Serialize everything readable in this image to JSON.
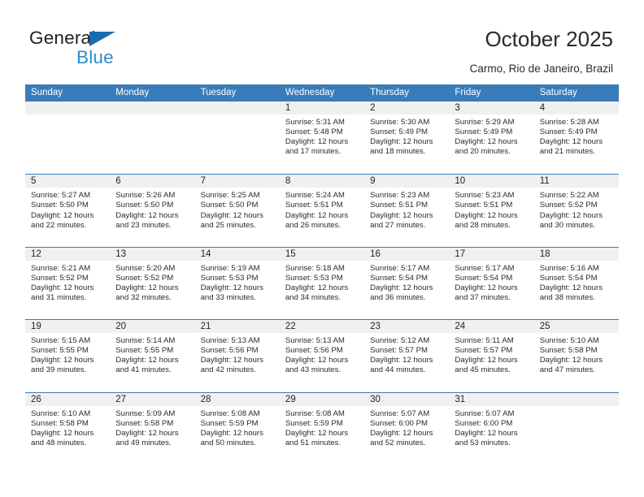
{
  "brand": {
    "name_part1": "General",
    "name_part2": "Blue",
    "triangle_icon": "triangle-icon",
    "accent_dark": "#1a6bb0",
    "accent_light": "#2e8bd0"
  },
  "header": {
    "title": "October 2025",
    "subtitle": "Carmo, Rio de Janeiro, Brazil"
  },
  "calendar": {
    "header_bg": "#3a7cb9",
    "daynum_bg": "#f0f0f0",
    "weekdays": [
      "Sunday",
      "Monday",
      "Tuesday",
      "Wednesday",
      "Thursday",
      "Friday",
      "Saturday"
    ],
    "weeks": [
      [
        {
          "day": "",
          "sunrise": "",
          "sunset": "",
          "daylight1": "",
          "daylight2": ""
        },
        {
          "day": "",
          "sunrise": "",
          "sunset": "",
          "daylight1": "",
          "daylight2": ""
        },
        {
          "day": "",
          "sunrise": "",
          "sunset": "",
          "daylight1": "",
          "daylight2": ""
        },
        {
          "day": "1",
          "sunrise": "Sunrise: 5:31 AM",
          "sunset": "Sunset: 5:48 PM",
          "daylight1": "Daylight: 12 hours",
          "daylight2": "and 17 minutes."
        },
        {
          "day": "2",
          "sunrise": "Sunrise: 5:30 AM",
          "sunset": "Sunset: 5:49 PM",
          "daylight1": "Daylight: 12 hours",
          "daylight2": "and 18 minutes."
        },
        {
          "day": "3",
          "sunrise": "Sunrise: 5:29 AM",
          "sunset": "Sunset: 5:49 PM",
          "daylight1": "Daylight: 12 hours",
          "daylight2": "and 20 minutes."
        },
        {
          "day": "4",
          "sunrise": "Sunrise: 5:28 AM",
          "sunset": "Sunset: 5:49 PM",
          "daylight1": "Daylight: 12 hours",
          "daylight2": "and 21 minutes."
        }
      ],
      [
        {
          "day": "5",
          "sunrise": "Sunrise: 5:27 AM",
          "sunset": "Sunset: 5:50 PM",
          "daylight1": "Daylight: 12 hours",
          "daylight2": "and 22 minutes."
        },
        {
          "day": "6",
          "sunrise": "Sunrise: 5:26 AM",
          "sunset": "Sunset: 5:50 PM",
          "daylight1": "Daylight: 12 hours",
          "daylight2": "and 23 minutes."
        },
        {
          "day": "7",
          "sunrise": "Sunrise: 5:25 AM",
          "sunset": "Sunset: 5:50 PM",
          "daylight1": "Daylight: 12 hours",
          "daylight2": "and 25 minutes."
        },
        {
          "day": "8",
          "sunrise": "Sunrise: 5:24 AM",
          "sunset": "Sunset: 5:51 PM",
          "daylight1": "Daylight: 12 hours",
          "daylight2": "and 26 minutes."
        },
        {
          "day": "9",
          "sunrise": "Sunrise: 5:23 AM",
          "sunset": "Sunset: 5:51 PM",
          "daylight1": "Daylight: 12 hours",
          "daylight2": "and 27 minutes."
        },
        {
          "day": "10",
          "sunrise": "Sunrise: 5:23 AM",
          "sunset": "Sunset: 5:51 PM",
          "daylight1": "Daylight: 12 hours",
          "daylight2": "and 28 minutes."
        },
        {
          "day": "11",
          "sunrise": "Sunrise: 5:22 AM",
          "sunset": "Sunset: 5:52 PM",
          "daylight1": "Daylight: 12 hours",
          "daylight2": "and 30 minutes."
        }
      ],
      [
        {
          "day": "12",
          "sunrise": "Sunrise: 5:21 AM",
          "sunset": "Sunset: 5:52 PM",
          "daylight1": "Daylight: 12 hours",
          "daylight2": "and 31 minutes."
        },
        {
          "day": "13",
          "sunrise": "Sunrise: 5:20 AM",
          "sunset": "Sunset: 5:52 PM",
          "daylight1": "Daylight: 12 hours",
          "daylight2": "and 32 minutes."
        },
        {
          "day": "14",
          "sunrise": "Sunrise: 5:19 AM",
          "sunset": "Sunset: 5:53 PM",
          "daylight1": "Daylight: 12 hours",
          "daylight2": "and 33 minutes."
        },
        {
          "day": "15",
          "sunrise": "Sunrise: 5:18 AM",
          "sunset": "Sunset: 5:53 PM",
          "daylight1": "Daylight: 12 hours",
          "daylight2": "and 34 minutes."
        },
        {
          "day": "16",
          "sunrise": "Sunrise: 5:17 AM",
          "sunset": "Sunset: 5:54 PM",
          "daylight1": "Daylight: 12 hours",
          "daylight2": "and 36 minutes."
        },
        {
          "day": "17",
          "sunrise": "Sunrise: 5:17 AM",
          "sunset": "Sunset: 5:54 PM",
          "daylight1": "Daylight: 12 hours",
          "daylight2": "and 37 minutes."
        },
        {
          "day": "18",
          "sunrise": "Sunrise: 5:16 AM",
          "sunset": "Sunset: 5:54 PM",
          "daylight1": "Daylight: 12 hours",
          "daylight2": "and 38 minutes."
        }
      ],
      [
        {
          "day": "19",
          "sunrise": "Sunrise: 5:15 AM",
          "sunset": "Sunset: 5:55 PM",
          "daylight1": "Daylight: 12 hours",
          "daylight2": "and 39 minutes."
        },
        {
          "day": "20",
          "sunrise": "Sunrise: 5:14 AM",
          "sunset": "Sunset: 5:55 PM",
          "daylight1": "Daylight: 12 hours",
          "daylight2": "and 41 minutes."
        },
        {
          "day": "21",
          "sunrise": "Sunrise: 5:13 AM",
          "sunset": "Sunset: 5:56 PM",
          "daylight1": "Daylight: 12 hours",
          "daylight2": "and 42 minutes."
        },
        {
          "day": "22",
          "sunrise": "Sunrise: 5:13 AM",
          "sunset": "Sunset: 5:56 PM",
          "daylight1": "Daylight: 12 hours",
          "daylight2": "and 43 minutes."
        },
        {
          "day": "23",
          "sunrise": "Sunrise: 5:12 AM",
          "sunset": "Sunset: 5:57 PM",
          "daylight1": "Daylight: 12 hours",
          "daylight2": "and 44 minutes."
        },
        {
          "day": "24",
          "sunrise": "Sunrise: 5:11 AM",
          "sunset": "Sunset: 5:57 PM",
          "daylight1": "Daylight: 12 hours",
          "daylight2": "and 45 minutes."
        },
        {
          "day": "25",
          "sunrise": "Sunrise: 5:10 AM",
          "sunset": "Sunset: 5:58 PM",
          "daylight1": "Daylight: 12 hours",
          "daylight2": "and 47 minutes."
        }
      ],
      [
        {
          "day": "26",
          "sunrise": "Sunrise: 5:10 AM",
          "sunset": "Sunset: 5:58 PM",
          "daylight1": "Daylight: 12 hours",
          "daylight2": "and 48 minutes."
        },
        {
          "day": "27",
          "sunrise": "Sunrise: 5:09 AM",
          "sunset": "Sunset: 5:58 PM",
          "daylight1": "Daylight: 12 hours",
          "daylight2": "and 49 minutes."
        },
        {
          "day": "28",
          "sunrise": "Sunrise: 5:08 AM",
          "sunset": "Sunset: 5:59 PM",
          "daylight1": "Daylight: 12 hours",
          "daylight2": "and 50 minutes."
        },
        {
          "day": "29",
          "sunrise": "Sunrise: 5:08 AM",
          "sunset": "Sunset: 5:59 PM",
          "daylight1": "Daylight: 12 hours",
          "daylight2": "and 51 minutes."
        },
        {
          "day": "30",
          "sunrise": "Sunrise: 5:07 AM",
          "sunset": "Sunset: 6:00 PM",
          "daylight1": "Daylight: 12 hours",
          "daylight2": "and 52 minutes."
        },
        {
          "day": "31",
          "sunrise": "Sunrise: 5:07 AM",
          "sunset": "Sunset: 6:00 PM",
          "daylight1": "Daylight: 12 hours",
          "daylight2": "and 53 minutes."
        },
        {
          "day": "",
          "sunrise": "",
          "sunset": "",
          "daylight1": "",
          "daylight2": ""
        }
      ]
    ]
  }
}
